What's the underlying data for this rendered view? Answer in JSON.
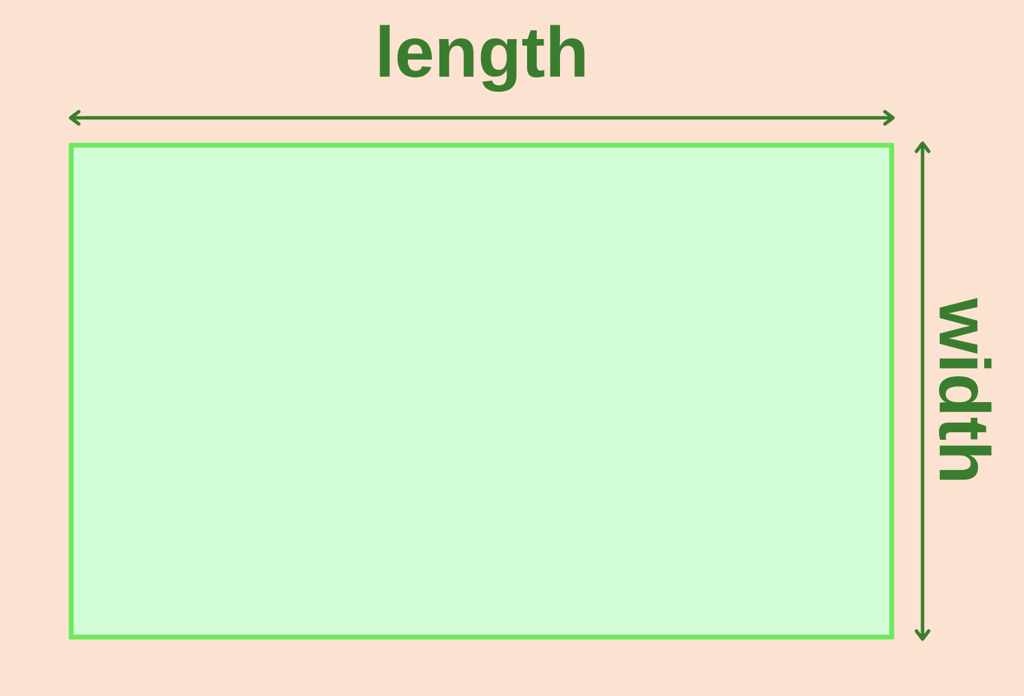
{
  "diagram": {
    "length_label": "length",
    "width_label": "width"
  },
  "colors": {
    "background": "#fce3d1",
    "rect_fill": "#d3fdd7",
    "rect_stroke": "#6ee85d",
    "annotation": "#3a7d2e"
  }
}
